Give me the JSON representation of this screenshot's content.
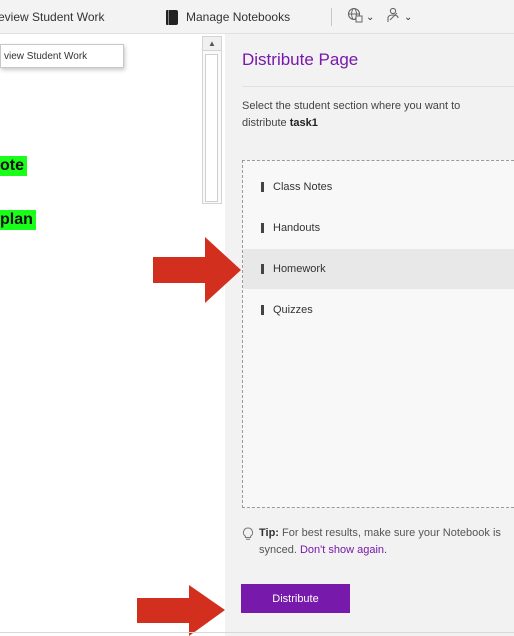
{
  "ribbon": {
    "review_label": "eview Student Work",
    "manage_label": "Manage Notebooks",
    "dropdown1_icon": "language-globe-icon",
    "dropdown2_icon": "accessibility-person-icon"
  },
  "tooltip": {
    "text": "view Student Work"
  },
  "page": {
    "line1": "ote",
    "line2": "plan",
    "highlight_color": "#19ff19"
  },
  "pane": {
    "title": "Distribute Page",
    "instruction_prefix": "Select the student section where you want to distribute",
    "instruction_task": "task1",
    "sections": [
      {
        "label": "Class Notes",
        "selected": false
      },
      {
        "label": "Handouts",
        "selected": false
      },
      {
        "label": "Homework",
        "selected": true
      },
      {
        "label": "Quizzes",
        "selected": false
      }
    ],
    "tip_label": "Tip:",
    "tip_text": "For best results, make sure your Notebook is synced.",
    "tip_link": "Don't show again.",
    "button_label": "Distribute"
  },
  "colors": {
    "accent": "#7719aa",
    "arrow": "#d32f1e",
    "pane_bg": "#f2f2f2"
  }
}
